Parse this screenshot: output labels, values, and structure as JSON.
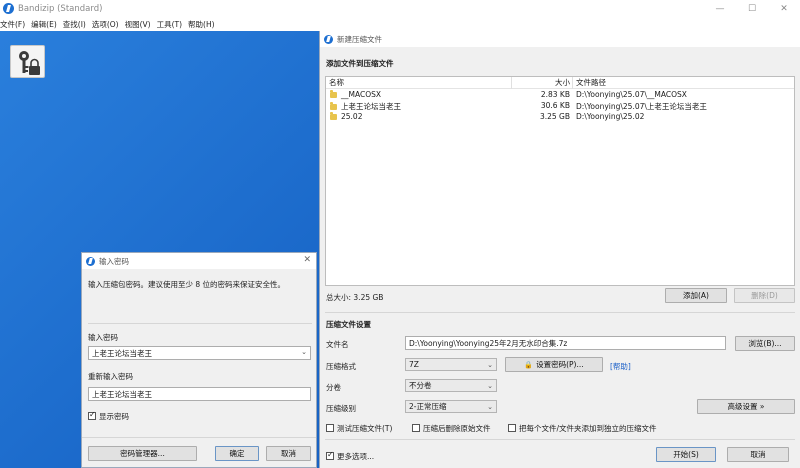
{
  "app": {
    "title": "Bandizip (Standard)",
    "menu": [
      "文件(F)",
      "编辑(E)",
      "查找(I)",
      "选项(O)",
      "视图(V)",
      "工具(T)",
      "帮助(H)"
    ],
    "window_controls": [
      "—",
      "☐",
      "✕"
    ]
  },
  "archive_dialog": {
    "title": "新建压缩文件",
    "add_section_title": "添加文件到压缩文件",
    "file_list": {
      "columns": [
        "名称",
        "大小",
        "文件路径"
      ],
      "rows": [
        {
          "name": "__MACOSX",
          "size": "2.83 KB",
          "path": "D:\\Yoonying\\25.07\\__MACOSX"
        },
        {
          "name": "上老王论坛当老王",
          "size": "30.6 KB",
          "path": "D:\\Yoonying\\25.07\\上老王论坛当老王"
        },
        {
          "name": "25.02",
          "size": "3.25 GB",
          "path": "D:\\Yoonying\\25.02"
        }
      ]
    },
    "total_size": "总大小: 3.25 GB",
    "add_button": "添加(A)",
    "delete_button": "删除(D)",
    "settings_title": "压缩文件设置",
    "filename_label": "文件名",
    "filename_value": "D:\\Yoonying\\Yoonying25年2月无水印合集.7z",
    "browse_button": "浏览(B)...",
    "format_label": "压缩格式",
    "format_value": "7Z",
    "set_password_button": "设置密码(P)...",
    "help_link": "[帮助]",
    "split_label": "分卷",
    "split_value": "不分卷",
    "level_label": "压缩级别",
    "level_value": "2-正常压缩",
    "advanced_button": "高级设置 »",
    "test_archive_label": "测试压缩文件(T)",
    "delete_original_label": "压缩后删除原始文件",
    "separate_archives_label": "把每个文件/文件夹添加到独立的压缩文件",
    "more_options_label": "更多选项...",
    "start_button": "开始(S)",
    "cancel_button": "取消"
  },
  "password_dialog": {
    "title": "输入密码",
    "instruction": "输入压缩包密码。建议使用至少 8 位的密码来保证安全性。",
    "enter_label": "输入密码",
    "enter_value": "上老王论坛当老王",
    "reenter_label": "重新输入密码",
    "reenter_value": "上老王论坛当老王",
    "show_password_label": "显示密码",
    "manager_button": "密码管理器...",
    "ok_button": "确定",
    "cancel_button": "取消"
  }
}
